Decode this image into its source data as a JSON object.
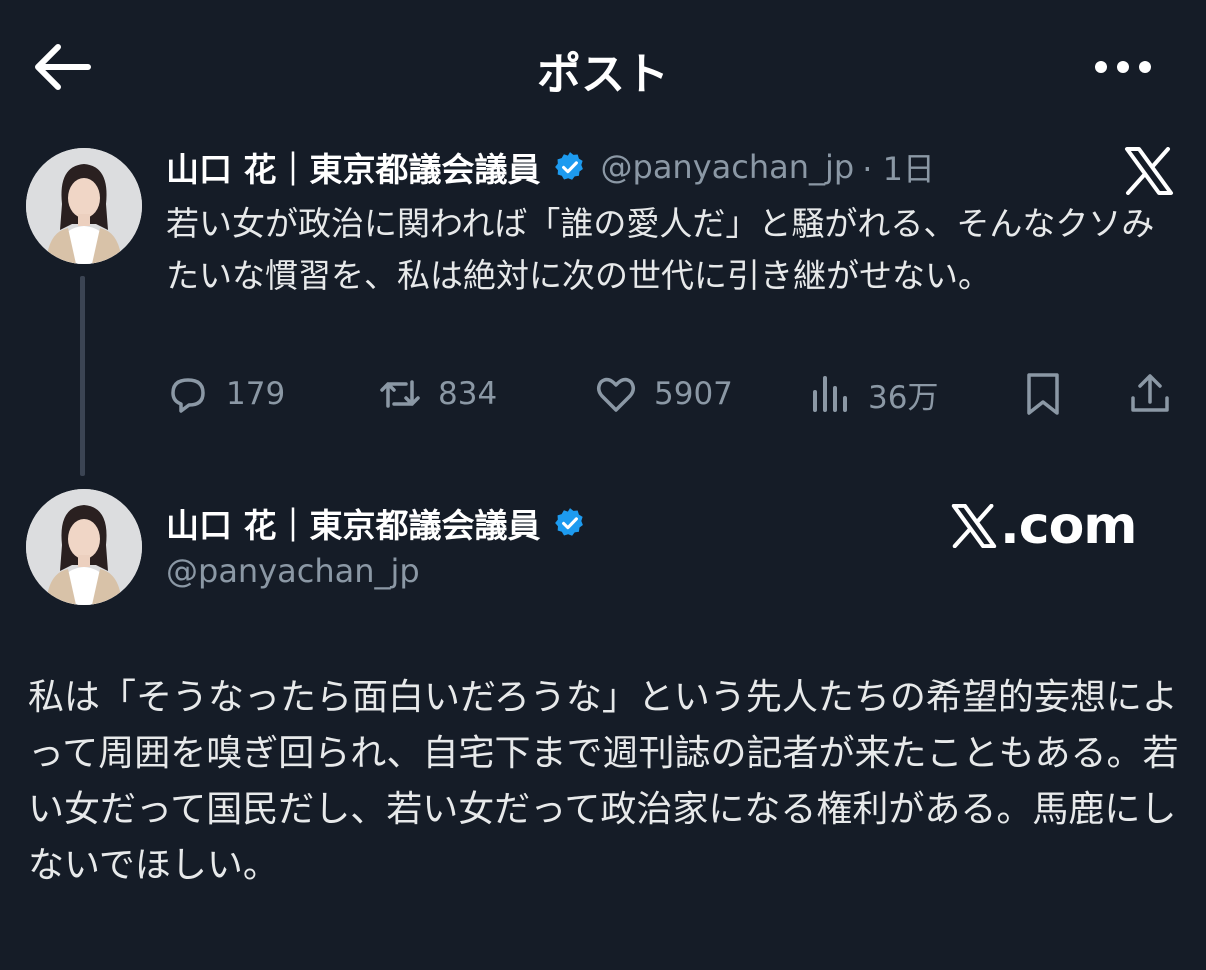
{
  "header": {
    "title": "ポスト",
    "back_icon": "arrow-left-icon",
    "more_icon": "more-horizontal-icon"
  },
  "reply_context_tweet": {
    "author_name": "山口 花｜東京都議会議員",
    "verified": true,
    "handle": "@panyachan_jp",
    "time": "· 1日",
    "text": "若い女が政治に関われば「誰の愛人だ」と騒がれる、そんなクソみたいな慣習を、私は絶対に次の世代に引き継がせない。",
    "stats": {
      "replies": "179",
      "reposts": "834",
      "likes": "5907",
      "views": "36万"
    }
  },
  "main_post": {
    "author_name": "山口 花｜東京都議会議員",
    "verified": true,
    "handle": "@panyachan_jp",
    "watermark": ".com",
    "text": "私は「そうなったら面白いだろうな」という先人たちの希望的妄想によって周囲を嗅ぎ回られ、自宅下まで週刊誌の記者が来たこともある。若い女だって国民だし、若い女だって政治家になる権利がある。馬鹿にしないでほしい。"
  },
  "colors": {
    "background": "#151c27",
    "text": "#e7e9ea",
    "muted": "#8b98a5",
    "verified": "#1d9bf0"
  }
}
